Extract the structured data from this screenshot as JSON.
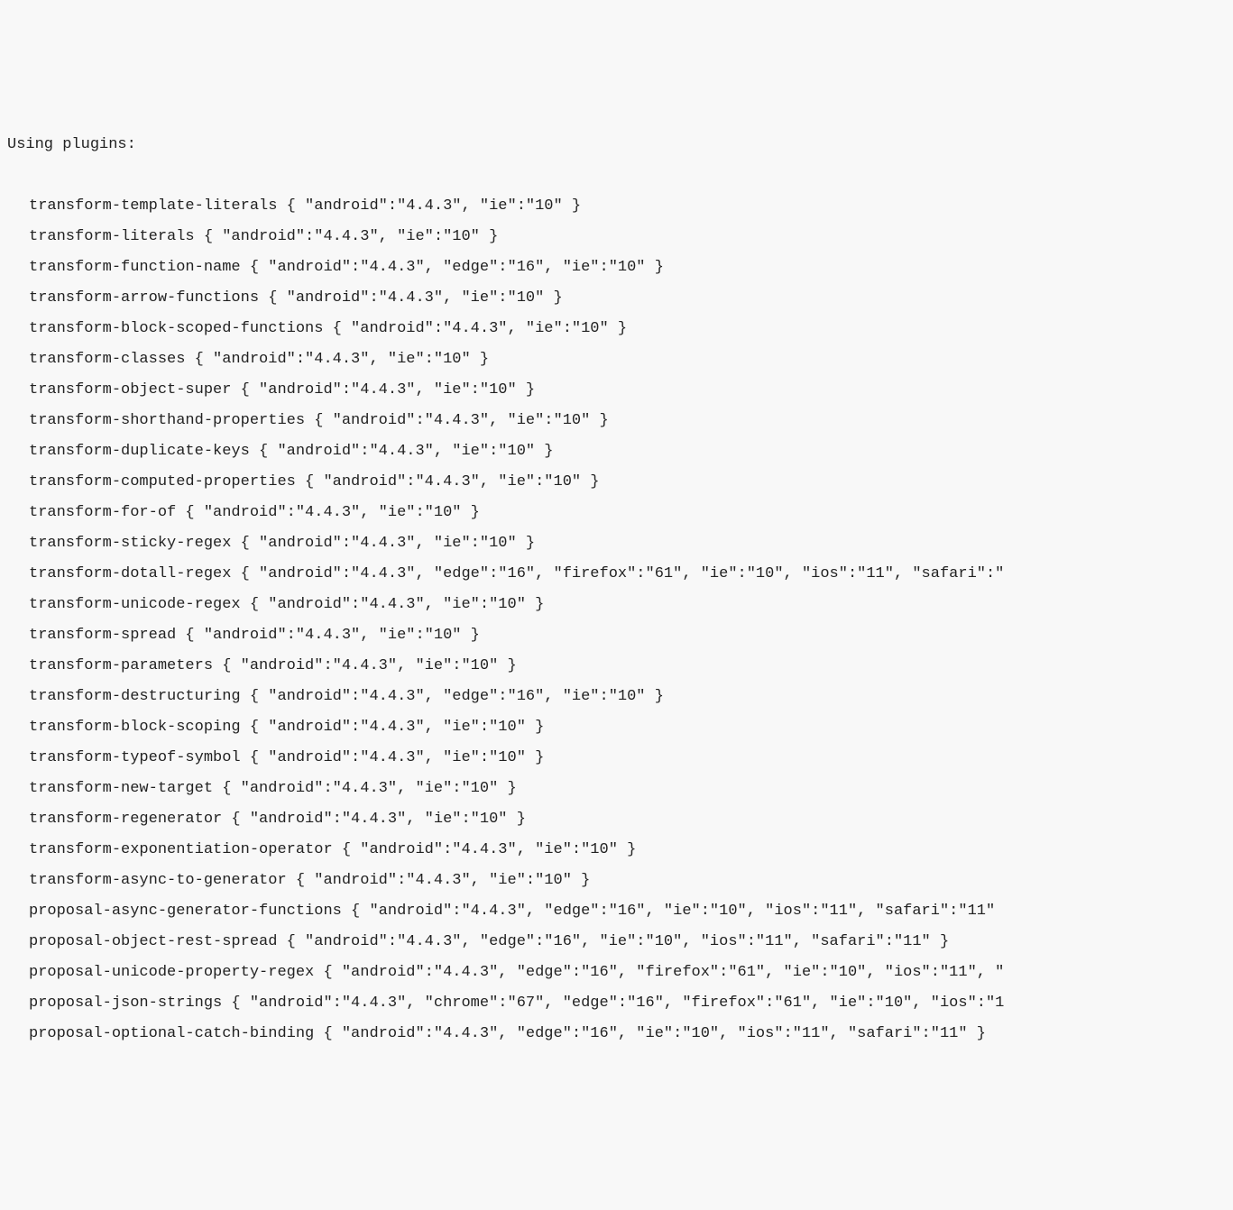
{
  "header": "Using plugins:",
  "lines": [
    "transform-template-literals { \"android\":\"4.4.3\", \"ie\":\"10\" }",
    "transform-literals { \"android\":\"4.4.3\", \"ie\":\"10\" }",
    "transform-function-name { \"android\":\"4.4.3\", \"edge\":\"16\", \"ie\":\"10\" }",
    "transform-arrow-functions { \"android\":\"4.4.3\", \"ie\":\"10\" }",
    "transform-block-scoped-functions { \"android\":\"4.4.3\", \"ie\":\"10\" }",
    "transform-classes { \"android\":\"4.4.3\", \"ie\":\"10\" }",
    "transform-object-super { \"android\":\"4.4.3\", \"ie\":\"10\" }",
    "transform-shorthand-properties { \"android\":\"4.4.3\", \"ie\":\"10\" }",
    "transform-duplicate-keys { \"android\":\"4.4.3\", \"ie\":\"10\" }",
    "transform-computed-properties { \"android\":\"4.4.3\", \"ie\":\"10\" }",
    "transform-for-of { \"android\":\"4.4.3\", \"ie\":\"10\" }",
    "transform-sticky-regex { \"android\":\"4.4.3\", \"ie\":\"10\" }",
    "transform-dotall-regex { \"android\":\"4.4.3\", \"edge\":\"16\", \"firefox\":\"61\", \"ie\":\"10\", \"ios\":\"11\", \"safari\":\"",
    "transform-unicode-regex { \"android\":\"4.4.3\", \"ie\":\"10\" }",
    "transform-spread { \"android\":\"4.4.3\", \"ie\":\"10\" }",
    "transform-parameters { \"android\":\"4.4.3\", \"ie\":\"10\" }",
    "transform-destructuring { \"android\":\"4.4.3\", \"edge\":\"16\", \"ie\":\"10\" }",
    "transform-block-scoping { \"android\":\"4.4.3\", \"ie\":\"10\" }",
    "transform-typeof-symbol { \"android\":\"4.4.3\", \"ie\":\"10\" }",
    "transform-new-target { \"android\":\"4.4.3\", \"ie\":\"10\" }",
    "transform-regenerator { \"android\":\"4.4.3\", \"ie\":\"10\" }",
    "transform-exponentiation-operator { \"android\":\"4.4.3\", \"ie\":\"10\" }",
    "transform-async-to-generator { \"android\":\"4.4.3\", \"ie\":\"10\" }",
    "proposal-async-generator-functions { \"android\":\"4.4.3\", \"edge\":\"16\", \"ie\":\"10\", \"ios\":\"11\", \"safari\":\"11\"",
    "proposal-object-rest-spread { \"android\":\"4.4.3\", \"edge\":\"16\", \"ie\":\"10\", \"ios\":\"11\", \"safari\":\"11\" }",
    "proposal-unicode-property-regex { \"android\":\"4.4.3\", \"edge\":\"16\", \"firefox\":\"61\", \"ie\":\"10\", \"ios\":\"11\", \"",
    "proposal-json-strings { \"android\":\"4.4.3\", \"chrome\":\"67\", \"edge\":\"16\", \"firefox\":\"61\", \"ie\":\"10\", \"ios\":\"1",
    "proposal-optional-catch-binding { \"android\":\"4.4.3\", \"edge\":\"16\", \"ie\":\"10\", \"ios\":\"11\", \"safari\":\"11\" }"
  ]
}
